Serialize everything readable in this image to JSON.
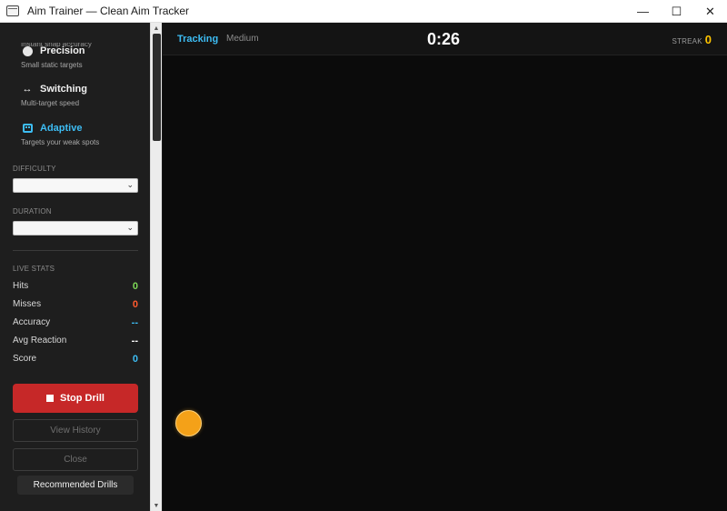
{
  "window": {
    "title": "Aim Trainer — Clean Aim Tracker",
    "controls": {
      "minimize": "—",
      "maximize": "☐",
      "close": "✕"
    }
  },
  "sidebar": {
    "clipped_text": "Instant snap accuracy",
    "modes": [
      {
        "label": "Precision",
        "description": "Small static targets",
        "icon": "dot-icon"
      },
      {
        "label": "Switching",
        "description": "Multi-target speed",
        "icon": "arrows-icon",
        "icon_glyph": "↔"
      },
      {
        "label": "Adaptive",
        "description": "Targets your weak spots",
        "icon": "robot-icon",
        "active": true
      }
    ],
    "difficulty_label": "DIFFICULTY",
    "duration_label": "DURATION",
    "stats_label": "LIVE STATS",
    "stats": [
      {
        "label": "Hits",
        "value": "0",
        "color": "#7ed957"
      },
      {
        "label": "Misses",
        "value": "0",
        "color": "#ff5a2e"
      },
      {
        "label": "Accuracy",
        "value": "--",
        "color": "#3dbdf4"
      },
      {
        "label": "Avg Reaction",
        "value": "--",
        "color": "#ffffff"
      },
      {
        "label": "Score",
        "value": "0",
        "color": "#3dbdf4"
      }
    ],
    "stop_label": "Stop Drill",
    "history_label": "View History",
    "close_label": "Close",
    "recommended_label": "Recommended Drills"
  },
  "game": {
    "mode": "Tracking",
    "difficulty": "Medium",
    "timer": "0:26",
    "streak_label": "STREAK",
    "streak_value": "0"
  },
  "colors": {
    "accent": "#3dbdf4",
    "stop": "#c62828",
    "target": "#f4a118",
    "streak": "#ffc400"
  }
}
